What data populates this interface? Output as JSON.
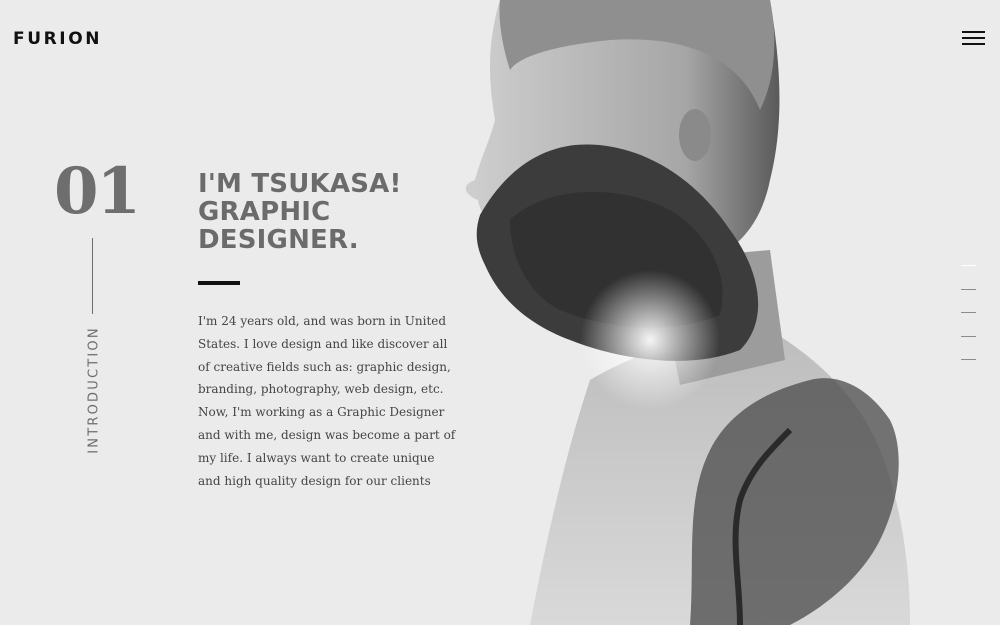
{
  "header": {
    "logo": "FURION",
    "menu_icon": "hamburger-menu-icon"
  },
  "section": {
    "number": "01",
    "label": "INTRODUCTION"
  },
  "intro": {
    "headline_lines": [
      "I'M TSUKASA!",
      "GRAPHIC",
      "DESIGNER."
    ],
    "bio": "I'm 24 years old, and was born in United States. I love design and like discover all of creative fields such as: graphic design, branding, photography, web design, etc. Now, I'm working as a Graphic Designer and with me, design was become a part of my life. I always want to create unique and high quality design for our clients"
  },
  "pagination": {
    "count": 5,
    "active_index": 0
  },
  "colors": {
    "background": "#ebebeb",
    "accent": "#111111",
    "heading": "#6b6b6b",
    "body_text": "#444444"
  }
}
